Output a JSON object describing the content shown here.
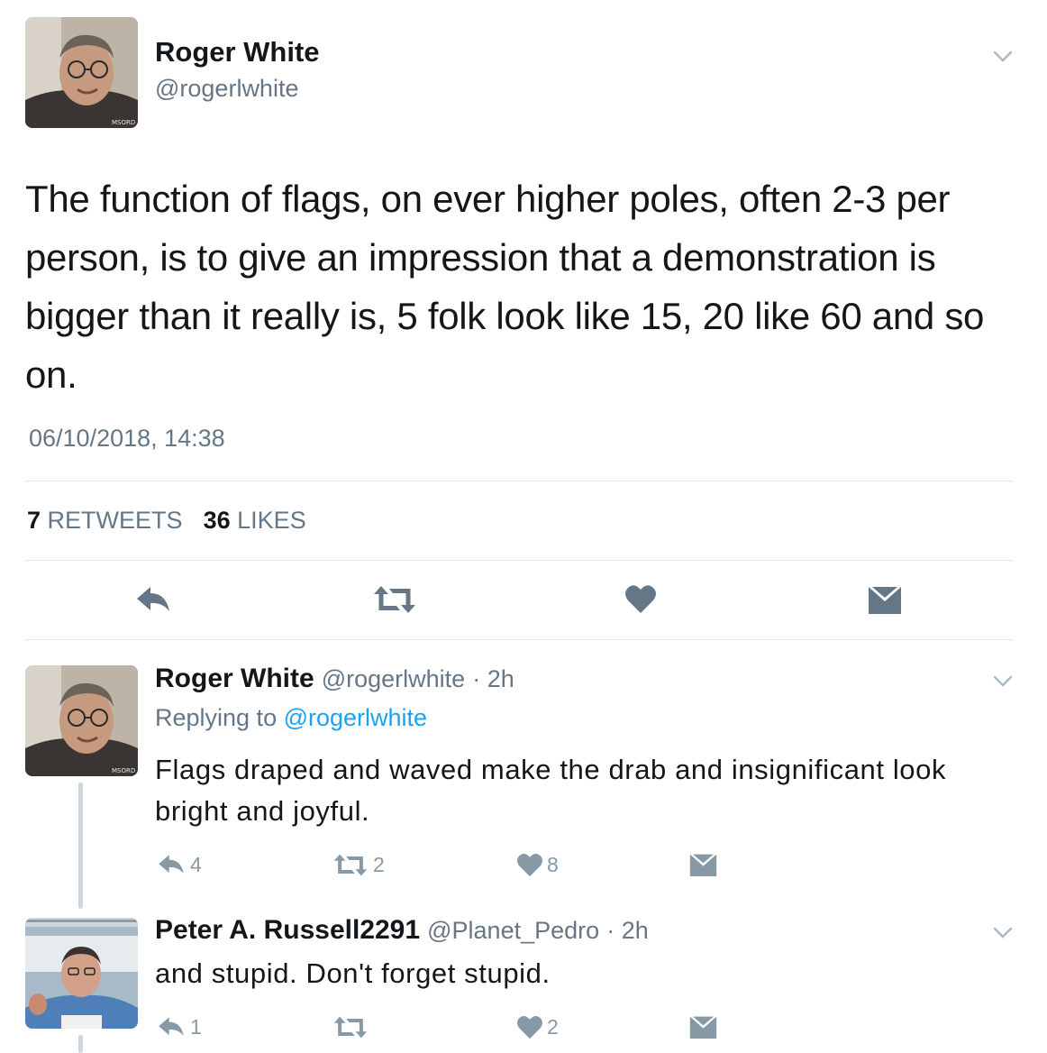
{
  "main_tweet": {
    "author_name": "Roger White",
    "handle": "@rogerlwhite",
    "text": "The function of flags, on ever higher poles, often 2-3 per person, is to give an impression that a demonstration is bigger than it really is, 5 folk look like 15, 20 like 60 and so on.",
    "timestamp": "06/10/2018, 14:38",
    "retweet_count": "7",
    "retweet_label": "RETWEETS",
    "like_count": "36",
    "like_label": "LIKES",
    "avatar_watermark": "MSORD"
  },
  "replies": [
    {
      "author_name": "Roger White",
      "handle": "@rogerlwhite",
      "time": "· 2h",
      "replying_prefix": "Replying to",
      "replying_to": "@rogerlwhite",
      "text": "Flags draped and waved make the drab and insignificant look bright and joyful.",
      "reply_count": "4",
      "retweet_count": "2",
      "like_count": "8",
      "avatar_watermark": "MSORD"
    },
    {
      "author_name": "Peter A. Russell2291",
      "handle": "@Planet_Pedro",
      "time": "· 2h",
      "text": "and stupid. Don't forget stupid.",
      "reply_count": "1",
      "retweet_count": "",
      "like_count": "2"
    }
  ],
  "icons": {
    "reply": "reply-icon",
    "retweet": "retweet-icon",
    "like": "heart-icon",
    "message": "envelope-icon",
    "more": "chevron-down-icon"
  },
  "colors": {
    "text": "#14171a",
    "muted": "#657786",
    "link": "#1da1f2",
    "action_gray": "#657786",
    "divider": "#e1e8ed"
  }
}
